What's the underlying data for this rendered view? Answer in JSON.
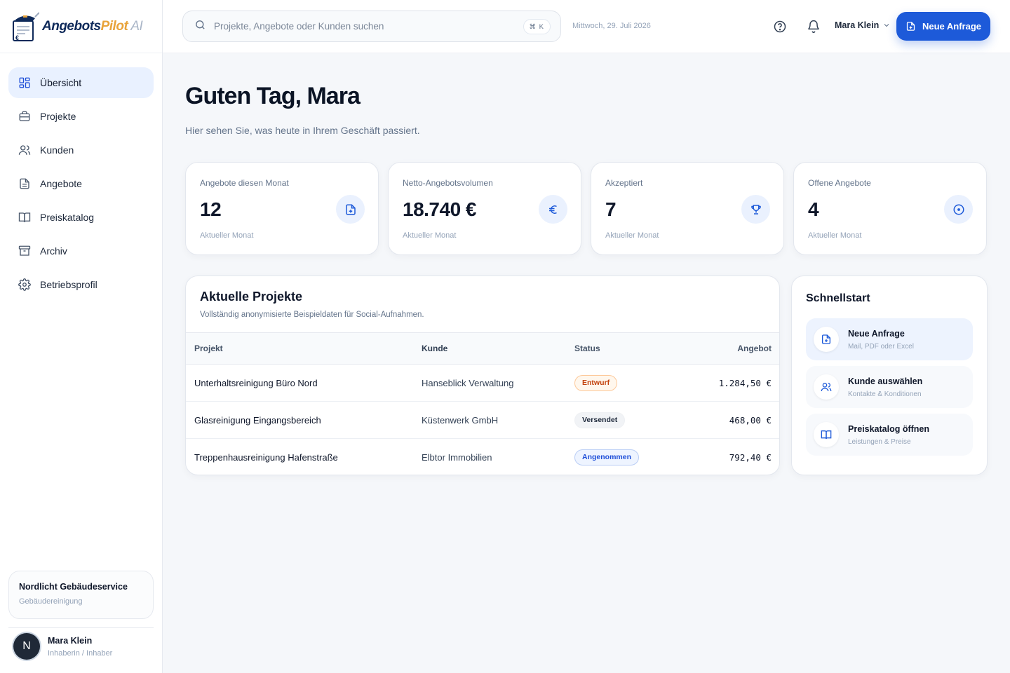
{
  "brand": {
    "part1": "Angebots",
    "part2": "Pilot",
    "part3": " AI"
  },
  "sidebar": {
    "items": [
      {
        "label": "Übersicht",
        "icon": "grid-icon",
        "active": true
      },
      {
        "label": "Projekte",
        "icon": "briefcase-icon"
      },
      {
        "label": "Kunden",
        "icon": "users-icon"
      },
      {
        "label": "Angebote",
        "icon": "document-icon"
      },
      {
        "label": "Preiskatalog",
        "icon": "book-icon"
      },
      {
        "label": "Archiv",
        "icon": "archive-icon"
      },
      {
        "label": "Betriebsprofil",
        "icon": "gear-icon"
      }
    ],
    "company": {
      "name": "Nordlicht Gebäudeservice",
      "sector": "Gebäudereinigung"
    },
    "user": {
      "initial": "N",
      "name": "Mara Klein",
      "role": "Inhaberin / Inhaber"
    }
  },
  "topbar": {
    "search_placeholder": "Projekte, Angebote oder Kunden suchen",
    "shortcut": "⌘ K",
    "date": "Mittwoch, 29. Juli 2026",
    "user_name": "Mara Klein",
    "cta_label": "Neue Anfrage"
  },
  "main": {
    "greeting": "Guten Tag, Mara",
    "subtitle": "Hier sehen Sie, was heute in Ihrem Geschäft passiert.",
    "kpis": [
      {
        "label": "Angebote diesen Monat",
        "value": "12",
        "caption": "Aktueller Monat",
        "icon": "file-plus-icon"
      },
      {
        "label": "Netto-Angebotsvolumen",
        "value": "18.740 €",
        "caption": "Aktueller Monat",
        "icon": "euro-icon"
      },
      {
        "label": "Akzeptiert",
        "value": "7",
        "caption": "Aktueller Monat",
        "icon": "trophy-icon"
      },
      {
        "label": "Offene Angebote",
        "value": "4",
        "caption": "Aktueller Monat",
        "icon": "clock-circle-icon"
      }
    ],
    "projects": {
      "title": "Aktuelle Projekte",
      "description": "Vollständig anonymisierte Beispieldaten für Social-Aufnahmen.",
      "columns": [
        "Projekt",
        "Kunde",
        "Status",
        "Angebot"
      ],
      "rows": [
        {
          "project": "Unterhaltsreinigung Büro Nord",
          "customer": "Hanseblick Verwaltung",
          "status": "Entwurf",
          "amount": "1.284,50 €"
        },
        {
          "project": "Glasreinigung Eingangsbereich",
          "customer": "Küstenwerk GmbH",
          "status": "Versendet",
          "amount": "468,00 €"
        },
        {
          "project": "Treppenhausreinigung Hafenstraße",
          "customer": "Elbtor Immobilien",
          "status": "Angenommen",
          "amount": "792,40 €"
        }
      ]
    },
    "quickstart": {
      "title": "Schnellstart",
      "items": [
        {
          "title": "Neue Anfrage",
          "subtitle": "Mail, PDF oder Excel",
          "icon": "file-plus-icon"
        },
        {
          "title": "Kunde auswählen",
          "subtitle": "Kontakte & Konditionen",
          "icon": "users-icon"
        },
        {
          "title": "Preiskatalog öffnen",
          "subtitle": "Leistungen & Preise",
          "icon": "book-icon"
        }
      ]
    }
  },
  "colors": {
    "accent": "#1d5ad9",
    "status_entwurf": "#c2410c",
    "status_versendet": "#1e293b",
    "status_angenommen": "#1d4ed8"
  }
}
